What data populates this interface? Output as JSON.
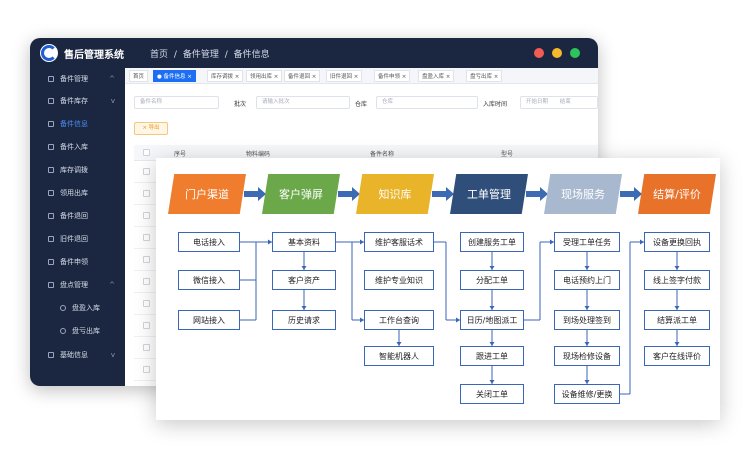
{
  "app": {
    "title": "售后管理系统",
    "breadcrumb": [
      "首页",
      "/",
      "备件管理",
      "/",
      "备件信息"
    ],
    "window_dots": [
      "#f25c54",
      "#f5b82e",
      "#2ec45c"
    ]
  },
  "sidebar": {
    "items": [
      {
        "label": "备件管理",
        "caret": "^",
        "active": false,
        "sub": false
      },
      {
        "label": "备件库存",
        "caret": "v",
        "active": false,
        "sub": false
      },
      {
        "label": "备件信息",
        "caret": "",
        "active": true,
        "sub": false
      },
      {
        "label": "备件入库",
        "caret": "",
        "active": false,
        "sub": false
      },
      {
        "label": "库存调拨",
        "caret": "",
        "active": false,
        "sub": false
      },
      {
        "label": "领用出库",
        "caret": "",
        "active": false,
        "sub": false
      },
      {
        "label": "备件退回",
        "caret": "",
        "active": false,
        "sub": false
      },
      {
        "label": "旧件退回",
        "caret": "",
        "active": false,
        "sub": false
      },
      {
        "label": "备件申领",
        "caret": "",
        "active": false,
        "sub": false
      },
      {
        "label": "盘点管理",
        "caret": "^",
        "active": false,
        "sub": false
      },
      {
        "label": "盘盈入库",
        "caret": "",
        "active": false,
        "sub": true
      },
      {
        "label": "盘亏出库",
        "caret": "",
        "active": false,
        "sub": true
      },
      {
        "label": "基础信息",
        "caret": "v",
        "active": false,
        "sub": false
      }
    ]
  },
  "tabs": [
    {
      "label": "首页",
      "active": false
    },
    {
      "label": "● 备件信息 ×",
      "active": true
    },
    {
      "label": "库存调拨 ×",
      "active": false
    },
    {
      "label": "领用出库 ×",
      "active": false
    },
    {
      "label": "备件退回 ×",
      "active": false
    },
    {
      "label": "旧件退回 ×",
      "active": false
    },
    {
      "label": "备件申领 ×",
      "active": false
    },
    {
      "label": "盘盈入库 ×",
      "active": false
    },
    {
      "label": "盘亏出库 ×",
      "active": false
    }
  ],
  "filters": {
    "name_placeholder": "备件名称",
    "batch_label": "批次",
    "batch_placeholder": "请输入批次",
    "warehouse_label": "仓库",
    "warehouse_placeholder": "仓库",
    "in_time_label": "入库时间",
    "start_date_placeholder": "开始日期",
    "end_date_placeholder": "结束"
  },
  "toolbar": {
    "export_label": "导出"
  },
  "table": {
    "headers": [
      "序号",
      "物料编码",
      "备件名称",
      "型号"
    ]
  },
  "flow": {
    "headers": [
      {
        "label": "门户渠道",
        "color": "#ef7d2d"
      },
      {
        "label": "客户弹屏",
        "color": "#6aa84a"
      },
      {
        "label": "知识库",
        "color": "#e9b32a"
      },
      {
        "label": "工单管理",
        "color": "#2f4f7a"
      },
      {
        "label": "现场服务",
        "color": "#a8b8ce"
      },
      {
        "label": "结算/评价",
        "color": "#e8722a"
      }
    ],
    "columns": [
      [
        "电话接入",
        "微信接入",
        "网站接入"
      ],
      [
        "基本资料",
        "客户资产",
        "历史请求"
      ],
      [
        "维护客服话术",
        "维护专业知识",
        "工作台查询",
        "智能机器人"
      ],
      [
        "创建服务工单",
        "分配工单",
        "日历/地图派工",
        "跟进工单",
        "关闭工单"
      ],
      [
        "受理工单任务",
        "电话预约上门",
        "到场处理签到",
        "现场检修设备",
        "设备维修/更换"
      ],
      [
        "设备更换回执",
        "线上签字付款",
        "结算派工单",
        "客户在线评价"
      ]
    ]
  }
}
